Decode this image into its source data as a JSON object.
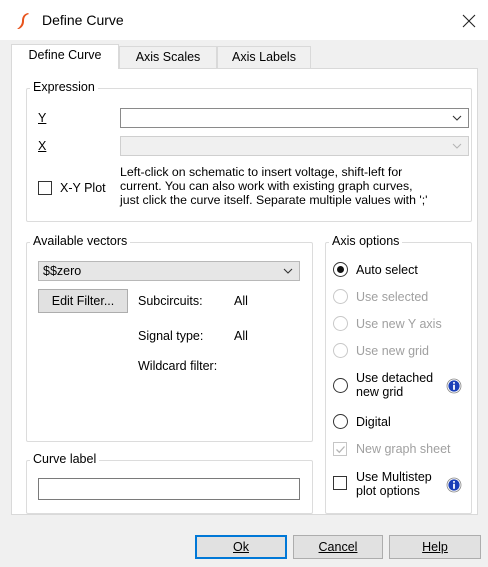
{
  "window": {
    "title": "Define Curve",
    "close_glyph": "✕"
  },
  "tabs": [
    {
      "label": "Define Curve",
      "active": true
    },
    {
      "label": "Axis Scales",
      "active": false
    },
    {
      "label": "Axis Labels",
      "active": false
    }
  ],
  "expression": {
    "group_title": "Expression",
    "y_label": "Y",
    "x_label": "X",
    "y_value": "",
    "x_value": "",
    "xy_plot_label": "X-Y Plot",
    "xy_plot_checked": false,
    "help_lines": [
      "Left-click on schematic to insert voltage, shift-left for",
      "current. You can also work with existing graph curves,",
      "just click the curve itself. Separate multiple values with ';'"
    ]
  },
  "vectors": {
    "group_title": "Available vectors",
    "selected": "$$zero",
    "edit_filter_label": "Edit Filter...",
    "subcircuits_label": "Subcircuits:",
    "subcircuits_value": "All",
    "signal_type_label": "Signal type:",
    "signal_type_value": "All",
    "wildcard_label": "Wildcard filter:"
  },
  "curve_label": {
    "group_title": "Curve label",
    "value": ""
  },
  "axis_options": {
    "group_title": "Axis options",
    "auto_select": "Auto select",
    "use_selected": "Use selected",
    "use_new_y_axis": "Use new Y axis",
    "use_new_grid": "Use new grid",
    "use_detached_line1": "Use detached",
    "use_detached_line2": "new grid",
    "digital": "Digital",
    "new_graph_sheet": "New graph sheet",
    "multistep_line1": "Use Multistep",
    "multistep_line2": "plot options",
    "selected_option": "auto_select"
  },
  "buttons": {
    "ok": "Ok",
    "cancel": "Cancel",
    "help": "Help"
  },
  "colors": {
    "accent": "#0078d7",
    "app_icon": "#e8531c",
    "info_icon": "#1a3fb8"
  }
}
